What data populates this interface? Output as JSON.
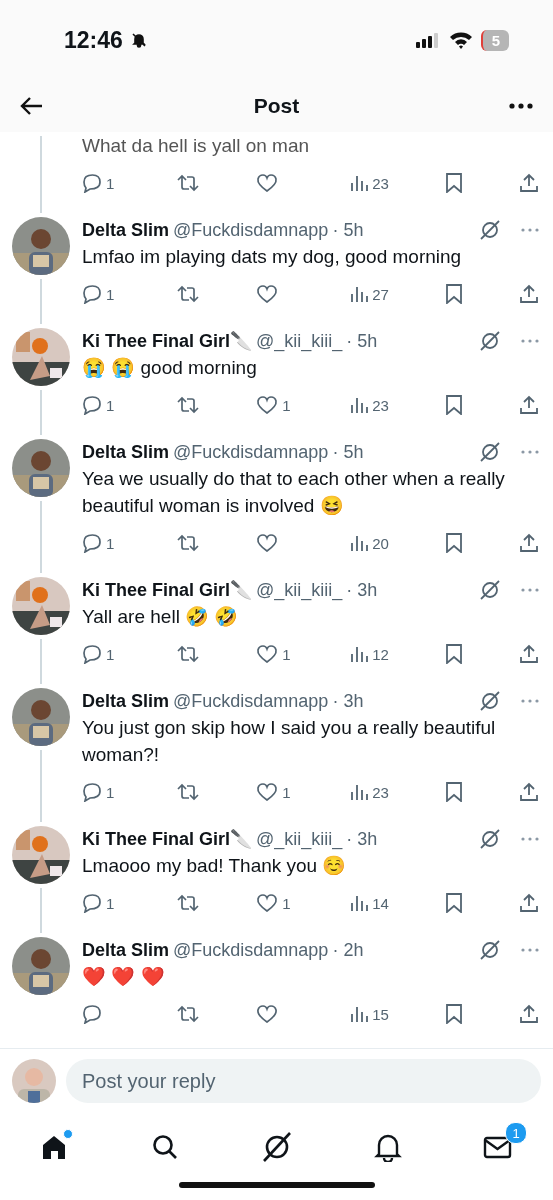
{
  "status_bar": {
    "time": "12:46",
    "battery": "5"
  },
  "header": {
    "title": "Post"
  },
  "cut_post": {
    "text": "What da hell is yall on man",
    "replies": "1",
    "views": "23"
  },
  "posts": [
    {
      "name": "Delta Slim",
      "handle": "@Fuckdisdamnapp",
      "time": "· 5h",
      "text": "Lmfao im playing dats my dog, good morning",
      "replies": "1",
      "views": "27"
    },
    {
      "name": "Ki Thee Final Girl🔪",
      "handle": "@_kii_kiii_",
      "time": "· 5h",
      "text": "😭 😭 good morning",
      "replies": "1",
      "likes": "1",
      "views": "23"
    },
    {
      "name": "Delta Slim",
      "handle": "@Fuckdisdamnapp",
      "time": "· 5h",
      "text": "Yea we usually do that to each other when a really beautiful woman is involved 😆",
      "replies": "1",
      "views": "20"
    },
    {
      "name": "Ki Thee Final Girl🔪",
      "handle": "@_kii_kiii_",
      "time": "· 3h",
      "text": "Yall are hell 🤣 🤣",
      "replies": "1",
      "likes": "1",
      "views": "12"
    },
    {
      "name": "Delta Slim",
      "handle": "@Fuckdisdamnapp",
      "time": "· 3h",
      "text": "You just gon skip how I said you a really beautiful woman?!",
      "replies": "1",
      "likes": "1",
      "views": "23"
    },
    {
      "name": "Ki Thee Final Girl🔪",
      "handle": "@_kii_kiii_",
      "time": "· 3h",
      "text": "Lmaooo my bad! Thank you ☺️",
      "replies": "1",
      "likes": "1",
      "views": "14"
    },
    {
      "name": "Delta Slim",
      "handle": "@Fuckdisdamnapp",
      "time": "· 2h",
      "text": "❤️ ❤️ ❤️",
      "views": "15"
    }
  ],
  "reply_bar": {
    "placeholder": "Post your reply"
  },
  "tab_bar": {
    "home_unread": true,
    "messages_badge": "1"
  }
}
